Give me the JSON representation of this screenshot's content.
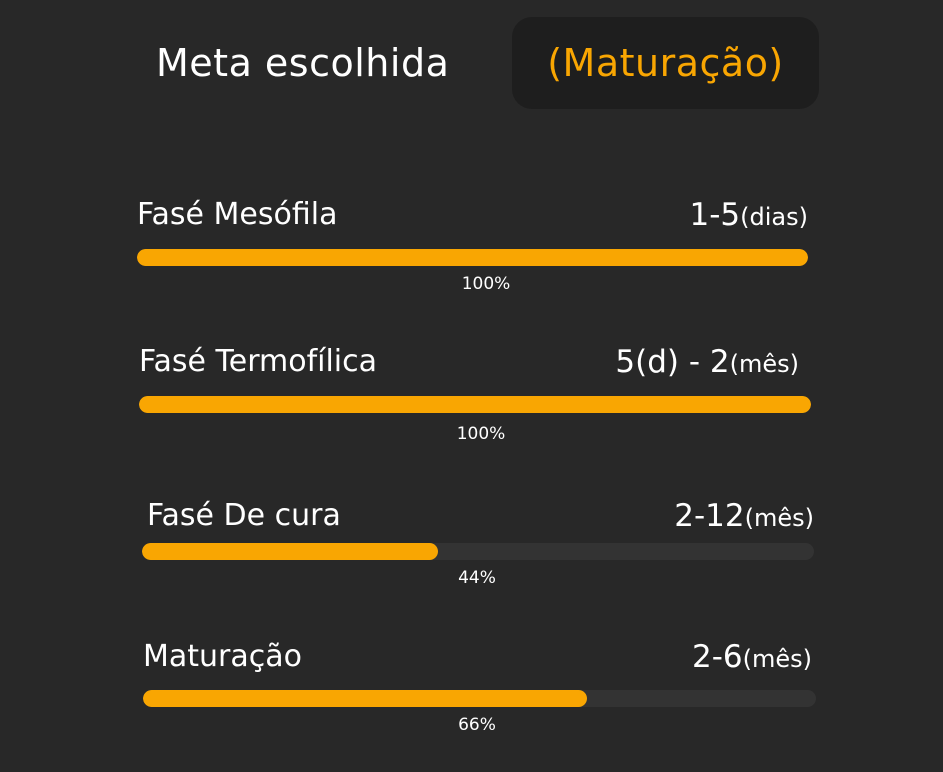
{
  "header": {
    "title": "Meta escolhida",
    "selected_goal": "(Maturação)"
  },
  "colors": {
    "background": "#282828",
    "chip_background": "#1e1e1e",
    "accent": "#f9a602",
    "track": "#333333",
    "text": "#ffffff"
  },
  "phases": [
    {
      "name": "Fasé Mesófila",
      "duration_value": "1-5",
      "duration_unit": "(dias)",
      "progress": 1.0,
      "percent_label": "100%"
    },
    {
      "name": "Fasé Termofílica",
      "duration_value": "5(d) - 2",
      "duration_unit": "(mês)",
      "progress": 1.0,
      "percent_label": "100%"
    },
    {
      "name": "Fasé De cura",
      "duration_value": "2-12",
      "duration_unit": "(mês)",
      "progress": 0.44,
      "percent_label": "44%"
    },
    {
      "name": "Maturação",
      "duration_value": "2-6",
      "duration_unit": "(mês)",
      "progress": 0.66,
      "percent_label": "66%"
    }
  ]
}
